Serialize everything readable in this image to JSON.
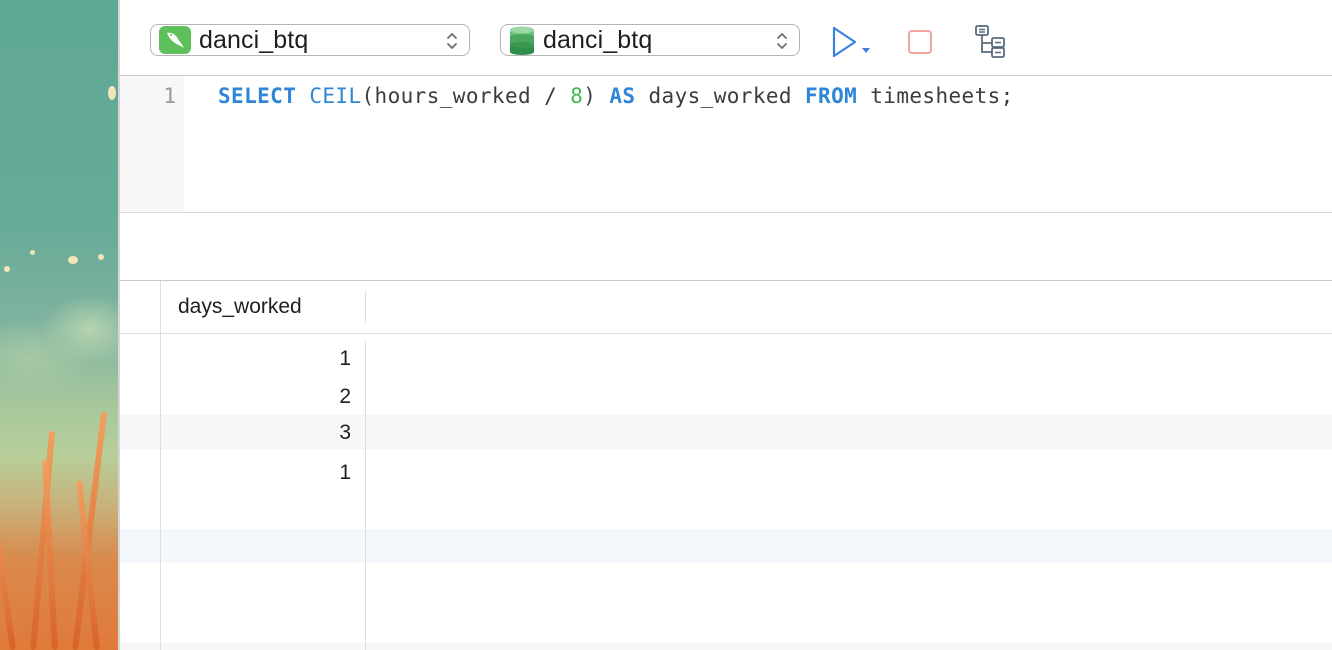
{
  "toolbar": {
    "connection": {
      "name": "danci_btq",
      "icon": "mysql-dolphin-icon"
    },
    "database": {
      "name": "danci_btq",
      "icon": "database-cylinder-icon"
    },
    "run_icon": "play-icon",
    "stop_icon": "stop-icon",
    "explain_icon": "explain-plan-icon"
  },
  "editor": {
    "line_numbers": [
      "1"
    ],
    "code_tokens": [
      {
        "text": "SELECT",
        "kind": "kw"
      },
      {
        "text": " ",
        "kind": "plain"
      },
      {
        "text": "CEIL",
        "kind": "fn"
      },
      {
        "text": "(hours_worked / ",
        "kind": "plain"
      },
      {
        "text": "8",
        "kind": "num"
      },
      {
        "text": ") ",
        "kind": "plain"
      },
      {
        "text": "AS",
        "kind": "kw"
      },
      {
        "text": " days_worked ",
        "kind": "plain"
      },
      {
        "text": "FROM",
        "kind": "kw"
      },
      {
        "text": " timesheets;",
        "kind": "plain"
      }
    ]
  },
  "results": {
    "columns": [
      "days_worked"
    ],
    "rows": [
      [
        "1"
      ],
      [
        "2"
      ],
      [
        "3"
      ],
      [
        "1"
      ]
    ]
  },
  "colors": {
    "keyword": "#2f86d7",
    "number": "#3cbc4c",
    "run": "#3b82e0",
    "stop": "#f0a89a"
  }
}
